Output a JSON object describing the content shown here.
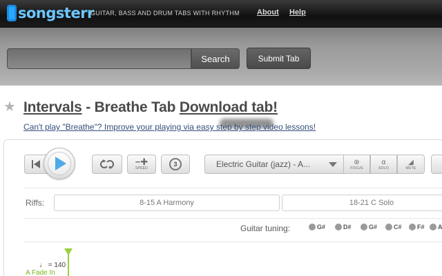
{
  "header": {
    "logo_text": "songsterr",
    "tagline": "GUITAR, BASS AND DRUM TABS WITH RHYTHM",
    "links": {
      "about": "About",
      "help": "Help"
    }
  },
  "search": {
    "value": "",
    "button_label": "Search",
    "submit_label": "Submit Tab"
  },
  "page": {
    "artist": "Intervals",
    "separator": " - ",
    "song_tab": "Breathe Tab",
    "download": "Download tab!",
    "promo": "Can't play \"Breathe\"? Improve your playing via easy step by step video lessons!"
  },
  "player": {
    "speed_label": "SPEED",
    "countin_value": "3",
    "instrument": "Electric Guitar (jazz) - A...",
    "focus_label": "FOCUS",
    "solo_label": "SOLO",
    "mute_label": "MUTE",
    "riffs_label": "Riffs:",
    "riffs": [
      "8-15 A Harmony",
      "18-21 C Solo"
    ],
    "tuning_label": "Guitar tuning:",
    "tuning_notes": [
      "G#",
      "D#",
      "G#",
      "C#",
      "F#",
      "A"
    ],
    "tempo": "♩ = 140",
    "section": "A Fade In"
  },
  "colors": {
    "logo": "#6cc7ff",
    "play": "#4ea9e8",
    "link": "#344e7a",
    "section": "#78b81e"
  }
}
